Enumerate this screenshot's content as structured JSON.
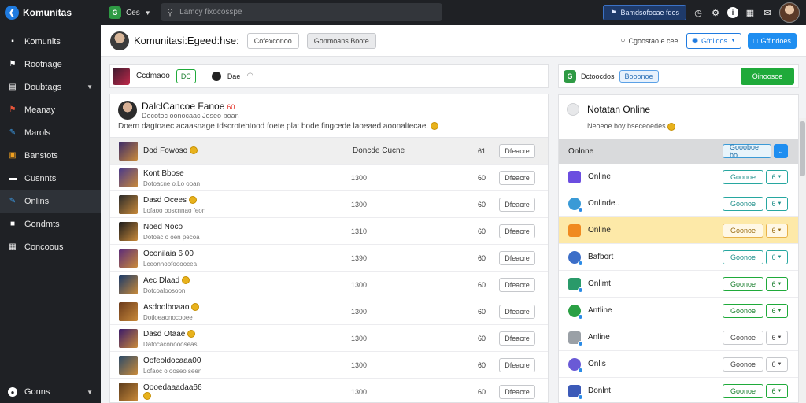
{
  "app": {
    "brand": "Komunitas",
    "nav_label": "Ces",
    "search_placeholder": "Lamcy fixocosspe"
  },
  "topbar": {
    "notif_label": "Bamdsofocae fdes"
  },
  "sidebar": {
    "items": [
      {
        "label": "Komunits",
        "icon": "users-icon"
      },
      {
        "label": "Rootnage",
        "icon": "bookmark-icon"
      },
      {
        "label": "Doubtags",
        "icon": "list-icon"
      },
      {
        "label": "Meanay",
        "icon": "flag-icon"
      },
      {
        "label": "Marols",
        "icon": "edit-icon"
      },
      {
        "label": "Banstots",
        "icon": "gift-icon"
      },
      {
        "label": "Cusnnts",
        "icon": "chat-icon"
      },
      {
        "label": "Onlins",
        "icon": "pencil-icon"
      },
      {
        "label": "Gondmts",
        "icon": "lock-icon"
      },
      {
        "label": "Concoous",
        "icon": "grid-icon"
      }
    ],
    "footer": "Gonns"
  },
  "header": {
    "title": "Komunitasi:Egeed:hse:",
    "btn1": "Cofexconoo",
    "btn2": "Gonmoans Boote",
    "link": "Cgoostao e.cee.",
    "btn_outline": "Gfnlldos",
    "btn_primary": "Gffindoes"
  },
  "left_top": {
    "label": "Ccdmaoo",
    "pill": "DC",
    "label2": "Dae"
  },
  "left_card": {
    "title": "DalclCancoe Fanoe",
    "badge": "60",
    "subtitle": "Docotoc oonocaac Joseo boan",
    "desc": "Doern dagtoaec acaasnage tdscrotehtood foete plat bode fingcede laoeaed aoonaltecae.",
    "rows": [
      {
        "name": "Dod Fowoso",
        "sub": "",
        "mid": "Doncde Cucne",
        "val": "61",
        "btn": "Dfeacre"
      },
      {
        "name": "Kont Bbose",
        "sub": "Dotoacne o.Lo ooan",
        "mid": "1300",
        "val": "60",
        "btn": "Dfeacre"
      },
      {
        "name": "Dasd Ocees",
        "sub": "Lofaoo boscnnao feon",
        "mid": "1300",
        "val": "60",
        "btn": "Dfeacre"
      },
      {
        "name": "Noed Noco",
        "sub": "Dotoac o oen pecoa",
        "mid": "1310",
        "val": "60",
        "btn": "Dfeacre"
      },
      {
        "name": "Oconilaia 6 00",
        "sub": "Lceonnoofoooocea",
        "mid": "1390",
        "val": "60",
        "btn": "Dfeacre"
      },
      {
        "name": "Aec Dlaad",
        "sub": "Dotcoaloosoon",
        "mid": "1300",
        "val": "60",
        "btn": "Dfeacre"
      },
      {
        "name": "Asdoolboaao",
        "sub": "Dotloeaonocooee",
        "mid": "1300",
        "val": "60",
        "btn": "Dfeacre"
      },
      {
        "name": "Dasd Otaae",
        "sub": "Datocaconoooseas",
        "mid": "1300",
        "val": "60",
        "btn": "Dfeacre"
      },
      {
        "name": "Oofeoldocaaa00",
        "sub": "Lofaoc o ooseo seen",
        "mid": "1300",
        "val": "60",
        "btn": "Dfeacre"
      },
      {
        "name": "Oooedaaadaa66",
        "sub": "",
        "mid": "1300",
        "val": "60",
        "btn": "Dfeacre"
      }
    ]
  },
  "right_top": {
    "label": "Dctoocdos",
    "pill": "Booonoe",
    "btn": "Oinoosoe"
  },
  "right_card": {
    "title": "Notatan Online",
    "sub": "Neoeoe boy bseceoedes",
    "bar_label": "Onlnne",
    "bar_btn": "Goooboe bo",
    "bar_small": "⌄",
    "rows": [
      {
        "label": "Online",
        "btn": "Goonoe",
        "btn2": "6"
      },
      {
        "label": "Onlinde..",
        "btn": "Goonoe",
        "btn2": "6"
      },
      {
        "label": "Online",
        "btn": "Goonoe",
        "btn2": "6"
      },
      {
        "label": "Bafbort",
        "btn": "Goonoe",
        "btn2": "6"
      },
      {
        "label": "Onlimt",
        "btn": "Goonoe",
        "btn2": "6"
      },
      {
        "label": "Antline",
        "btn": "Goonoe",
        "btn2": "6"
      },
      {
        "label": "Anline",
        "btn": "Goonoe",
        "btn2": "6"
      },
      {
        "label": "Onlis",
        "btn": "Goonoe",
        "btn2": "6"
      },
      {
        "label": "Donlnt",
        "btn": "Goonoe",
        "btn2": "6"
      }
    ]
  },
  "colors": {
    "accent": "#1f8ef0",
    "green": "#1faa3a",
    "highlight": "#fde9a8",
    "sidebar": "#1f2125"
  }
}
